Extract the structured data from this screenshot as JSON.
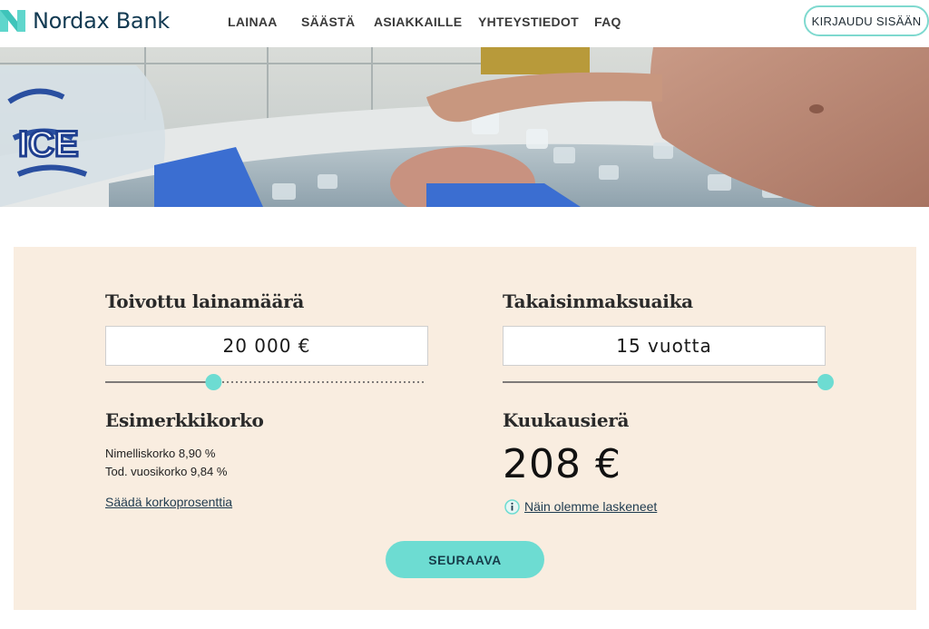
{
  "header": {
    "brand": "Nordax Bank",
    "nav": [
      "LAINAA",
      "SÄÄSTÄ",
      "ASIAKKAILLE",
      "YHTEYSTIEDOT",
      "FAQ"
    ],
    "login_label": "KIRJAUDU SISÄÄN",
    "brand_color": "#123a52",
    "accent_color": "#6ddcd2"
  },
  "hero": {
    "icon": "ice-bath-photo",
    "bag_text": "ICE"
  },
  "calculator": {
    "amount_label": "Toivottu lainamäärä",
    "amount_value": "20 000 €",
    "amount_slider_fraction": 0.32,
    "term_label": "Takaisinmaksuaika",
    "term_value": "15 vuotta",
    "term_slider_fraction": 1.0,
    "rate_heading": "Esimerkkikorko",
    "nominal_rate": "Nimelliskorko 8,90 %",
    "effective_rate": "Tod. vuosikorko 9,84 %",
    "adjust_link": "Säädä korkoprosenttia",
    "monthly_heading": "Kuukausierä",
    "monthly_amount": "208 €",
    "calc_link": "Näin olemme laskeneet",
    "next_label": "SEURAAVA",
    "panel_color": "#f9ede0"
  }
}
